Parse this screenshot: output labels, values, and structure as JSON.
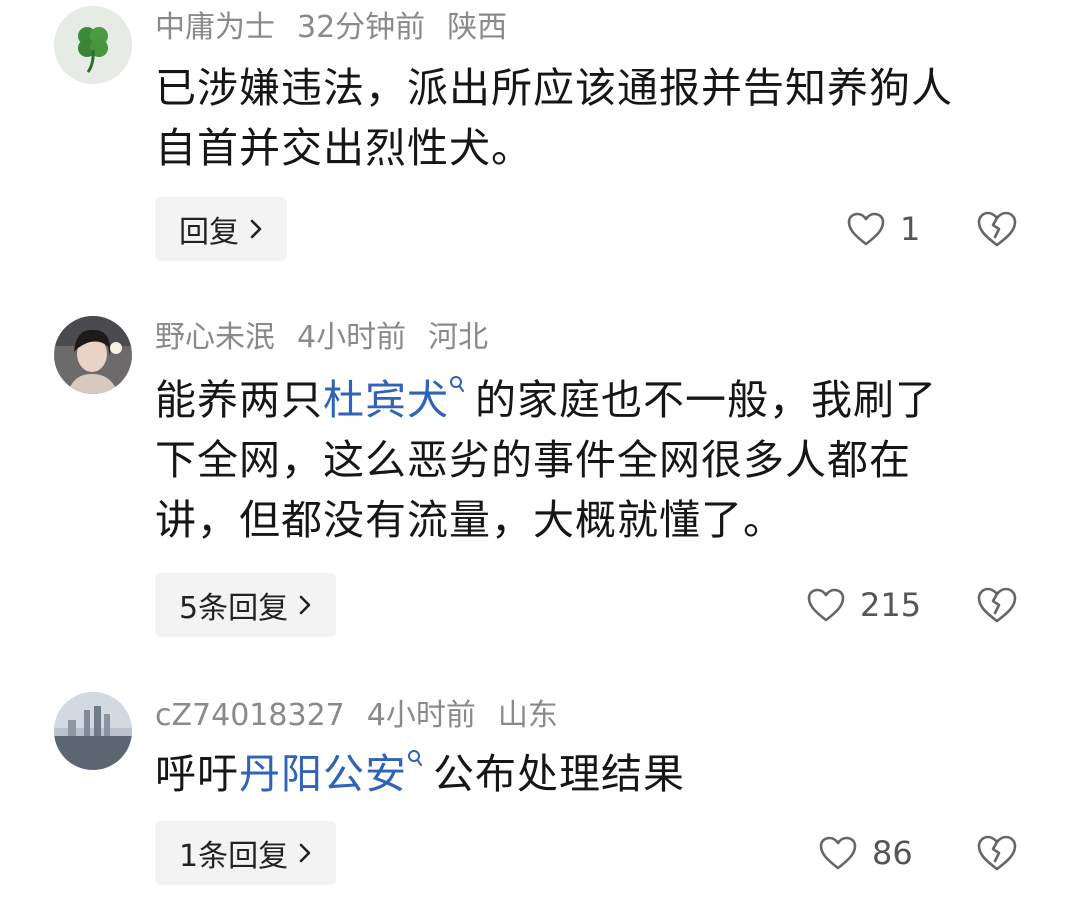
{
  "comments": [
    {
      "username": "中庸为士",
      "time": "32分钟前",
      "location": "陕西",
      "text_line1": "已涉嫌违法，派出所应该通报并告知养狗人",
      "text_line2": "自首并交出烈性犬。",
      "reply_label": "回复",
      "like_count": "1",
      "avatar_icon": "clover-icon"
    },
    {
      "username": "野心未泯",
      "time": "4小时前",
      "location": "河北",
      "text_before_link": "能养两只",
      "link_text": "杜宾犬",
      "text_after_link": "的家庭也不一般，我刷了",
      "text_line2": "下全网，这么恶劣的事件全网很多人都在",
      "text_line3": "讲，但都没有流量，大概就懂了。",
      "reply_label": "5条回复",
      "like_count": "215",
      "avatar_icon": "person-photo-icon"
    },
    {
      "username": "cZ74018327",
      "time": "4小时前",
      "location": "山东",
      "text_before_link": "呼吁",
      "link_text": "丹阳公安",
      "text_after_link": "公布处理结果",
      "reply_label": "1条回复",
      "like_count": "86",
      "avatar_icon": "cityscape-icon"
    }
  ],
  "colors": {
    "link": "#2f62b8",
    "meta": "#8a8a8a",
    "text": "#161616",
    "reply_bg": "#f3f3f3"
  }
}
